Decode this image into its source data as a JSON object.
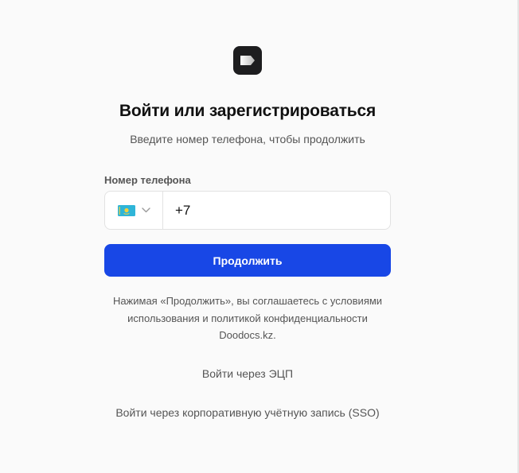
{
  "header": {
    "logo_icon": "doodocs-logo-icon",
    "title": "Войти или зарегистрироваться",
    "subtitle": "Введите номер телефона, чтобы продолжить"
  },
  "phone_field": {
    "label": "Номер телефона",
    "country_flag_icon": "kazakhstan-flag-icon",
    "dropdown_icon": "chevron-down-icon",
    "value": "+7"
  },
  "continue_button": {
    "label": "Продолжить",
    "color": "#1847e6"
  },
  "consent": {
    "lines": [
      "Нажимая «Продолжить», вы соглашаетесь с условиями",
      "использования и политикой конфиденциальности",
      "Doodocs.kz."
    ]
  },
  "alt_logins": {
    "eds_label": "Войти через ЭЦП",
    "sso_label": "Войти через корпоративную учётную запись (SSO)"
  }
}
